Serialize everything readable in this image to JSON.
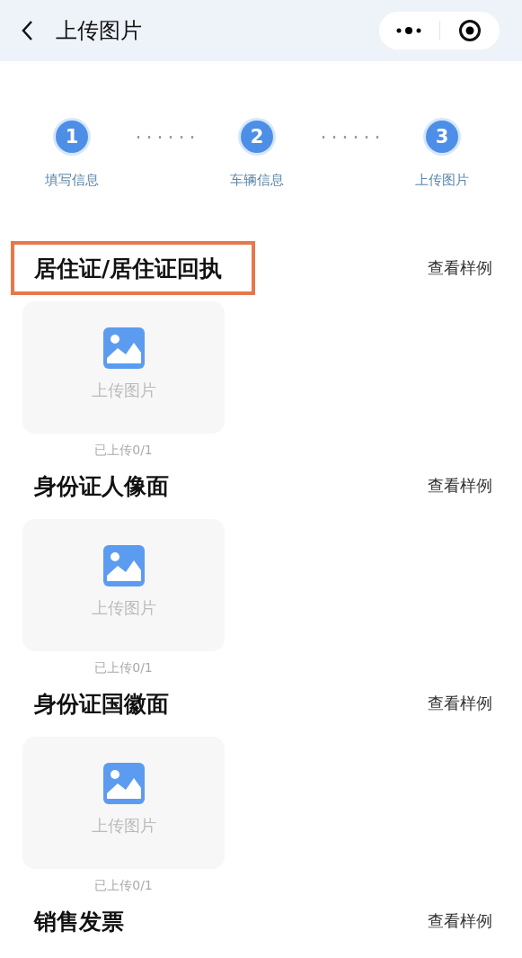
{
  "header": {
    "title": "上传图片"
  },
  "steps": [
    {
      "number": "1",
      "label": "填写信息"
    },
    {
      "number": "2",
      "label": "车辆信息"
    },
    {
      "number": "3",
      "label": "上传图片"
    }
  ],
  "sections": [
    {
      "title": "居住证/居住证回执",
      "highlighted": true,
      "link": "查看样例",
      "upload_label": "上传图片",
      "count": "已上传0/1"
    },
    {
      "title": "身份证人像面",
      "highlighted": false,
      "link": "查看样例",
      "upload_label": "上传图片",
      "count": "已上传0/1"
    },
    {
      "title": "身份证国徽面",
      "highlighted": false,
      "link": "查看样例",
      "upload_label": "上传图片",
      "count": "已上传0/1"
    },
    {
      "title": "销售发票",
      "highlighted": false,
      "link": "查看样例"
    }
  ]
}
